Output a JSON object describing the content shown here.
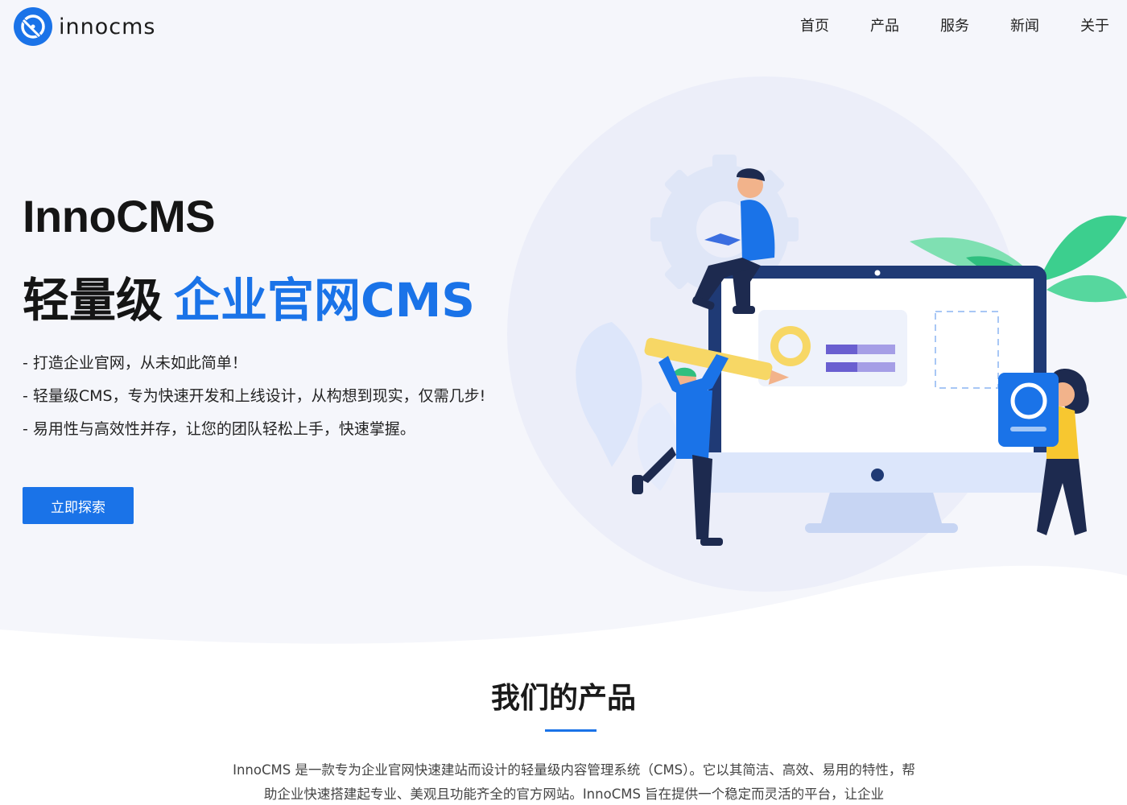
{
  "brand": {
    "name": "innocms",
    "accent": "#1a73e8"
  },
  "nav": {
    "items": [
      {
        "label": "首页"
      },
      {
        "label": "产品"
      },
      {
        "label": "服务"
      },
      {
        "label": "新闻"
      },
      {
        "label": "关于"
      }
    ]
  },
  "hero": {
    "title": "InnoCMS",
    "subtitle_plain": "轻量级",
    "subtitle_accent": "企业官网CMS",
    "features": [
      "- 打造企业官网，从未如此简单！",
      "- 轻量级CMS，专为快速开发和上线设计，从构想到现实，仅需几步!",
      "- 易用性与高效性并存，让您的团队轻松上手，快速掌握。"
    ],
    "cta_label": "立即探索"
  },
  "products": {
    "title": "我们的产品",
    "description": "InnoCMS 是一款专为企业官网快速建站而设计的轻量级内容管理系统（CMS）。它以其简洁、高效、易用的特性，帮助企业快速搭建起专业、美观且功能齐全的官方网站。InnoCMS 旨在提供一个稳定而灵活的平台，让企业"
  }
}
